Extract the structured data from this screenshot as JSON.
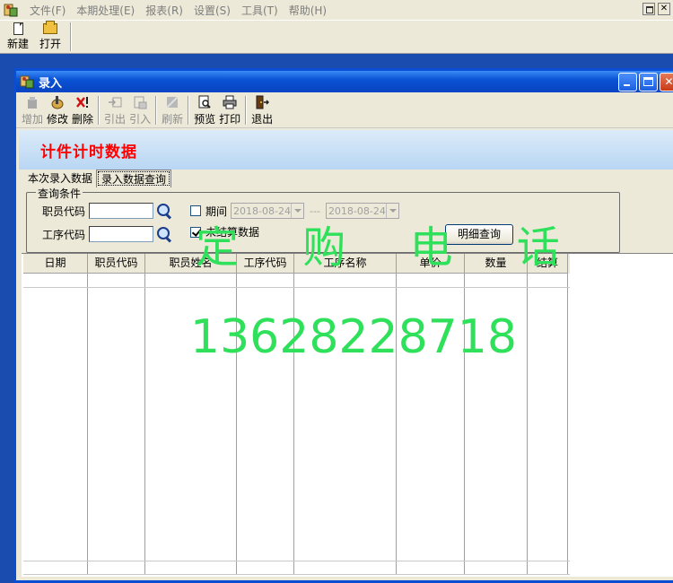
{
  "menubar": {
    "items": [
      {
        "label": "文件",
        "key": "(F)"
      },
      {
        "label": "本期处理",
        "key": "(E)"
      },
      {
        "label": "报表",
        "key": "(R)"
      },
      {
        "label": "设置",
        "key": "(S)"
      },
      {
        "label": "工具",
        "key": "(T)"
      },
      {
        "label": "帮助",
        "key": "(H)"
      }
    ]
  },
  "main_toolbar": {
    "new_label": "新建",
    "open_label": "打开"
  },
  "child_window": {
    "title": "录入",
    "toolbar": [
      {
        "label": "增加",
        "icon": "add-icon",
        "enabled": false
      },
      {
        "label": "修改",
        "icon": "edit-icon",
        "enabled": true
      },
      {
        "label": "删除",
        "icon": "delete-icon",
        "enabled": true
      },
      {
        "label": "引出",
        "icon": "export-icon",
        "enabled": false
      },
      {
        "label": "引入",
        "icon": "import-icon",
        "enabled": false
      },
      {
        "label": "刷新",
        "icon": "refresh-icon",
        "enabled": false
      },
      {
        "label": "预览",
        "icon": "preview-icon",
        "enabled": true
      },
      {
        "label": "打印",
        "icon": "print-icon",
        "enabled": true
      },
      {
        "label": "退出",
        "icon": "exit-icon",
        "enabled": true
      }
    ],
    "banner_title": "计件计时数据",
    "tabs": [
      {
        "label": "本次录入数据",
        "active": false
      },
      {
        "label": "录入数据查询",
        "active": true
      }
    ],
    "query": {
      "group_label": "查询条件",
      "employee_code_label": "职员代码",
      "employee_code_value": "",
      "process_code_label": "工序代码",
      "process_code_value": "",
      "period_label": "期间",
      "period_checked": false,
      "date_from": "2018-08-24",
      "date_to": "2018-08-24",
      "date_separator": "---",
      "unsettled_label": "未结算数据",
      "unsettled_checked": true,
      "detail_button": "明细查询"
    },
    "grid": {
      "columns": [
        "日期",
        "职员代码",
        "职员姓名",
        "工序代码",
        "工序名称",
        "单价",
        "数量",
        "结算"
      ]
    }
  },
  "watermark": {
    "title": "定 购 电 话",
    "phone": "13628228718",
    "color": "#2ee05a"
  },
  "colors": {
    "desktop": "#1a4cb0",
    "chrome": "#ece9d8",
    "banner_title": "#ff0000",
    "titlebar": "#0b53d6"
  }
}
